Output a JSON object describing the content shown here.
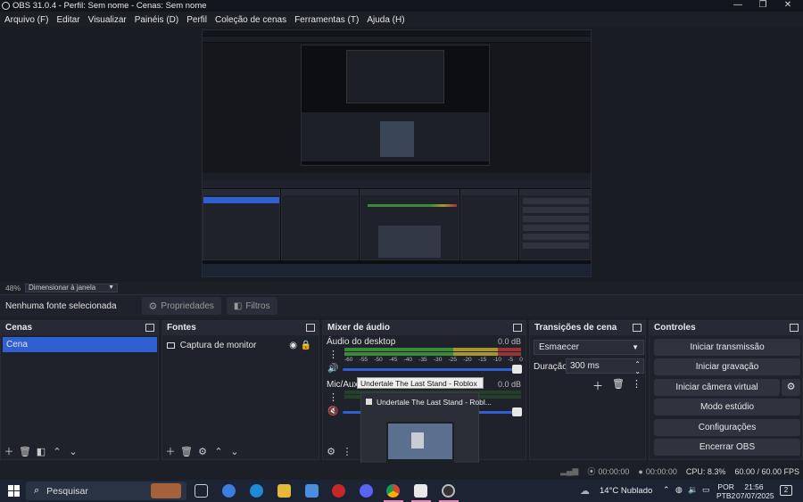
{
  "window": {
    "title": "OBS 31.0.4 - Perfil: Sem nome - Cenas: Sem nome"
  },
  "menu": [
    "Arquivo (F)",
    "Editar",
    "Visualizar",
    "Painéis (D)",
    "Perfil",
    "Coleção de cenas",
    "Ferramentas (T)",
    "Ajuda (H)"
  ],
  "zoom": {
    "percent": "48%",
    "mode": "Dimensionar à janela"
  },
  "source_toolbar": {
    "no_source": "Nenhuma fonte selecionada",
    "properties": "Propriedades",
    "filters": "Filtros"
  },
  "scenes": {
    "title": "Cenas",
    "items": [
      "Cena"
    ]
  },
  "sources": {
    "title": "Fontes",
    "items": [
      "Captura de monitor"
    ]
  },
  "mixer": {
    "title": "Mixer de áudio",
    "channels": [
      {
        "name": "Áudio do desktop",
        "db": "0.0 dB"
      },
      {
        "name": "Mic/Aux",
        "db": "0.0 dB"
      }
    ],
    "scale": [
      "-60",
      "-55",
      "-50",
      "-45",
      "-40",
      "-35",
      "-30",
      "-25",
      "-20",
      "-15",
      "-10",
      "-5",
      "0"
    ]
  },
  "transitions": {
    "title": "Transições de cena",
    "selected": "Esmaecer",
    "duration_label": "Duração",
    "duration_value": "300 ms"
  },
  "controls": {
    "title": "Controles",
    "buttons": [
      "Iniciar transmissão",
      "Iniciar gravação",
      "Iniciar câmera virtual",
      "Modo estúdio",
      "Configurações",
      "Encerrar OBS"
    ]
  },
  "tooltip": {
    "text": "Undertale The Last Stand - Roblox Studio"
  },
  "thumbnail": {
    "title": "Undertale The Last Stand - Robl..."
  },
  "status": {
    "stream_time": "00:00:00",
    "rec_time": "00:00:00",
    "cpu": "CPU: 8.3%",
    "fps": "60.00 / 60.00 FPS"
  },
  "taskbar": {
    "search_placeholder": "Pesquisar",
    "weather": "14°C  Nublado",
    "lang1": "POR",
    "lang2": "PTB2",
    "time": "21:56",
    "date": "07/07/2025",
    "notif_count": "2"
  },
  "colors": {
    "accent": "#2f5fd0",
    "meter_green": "#3a8a3a",
    "meter_yellow": "#a89530",
    "meter_red": "#9a3535"
  }
}
